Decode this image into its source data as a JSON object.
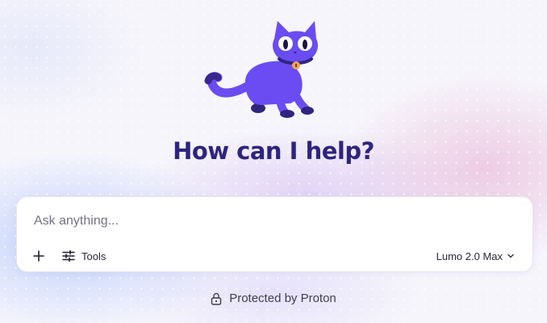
{
  "header": {
    "title": "How can I help?"
  },
  "composer": {
    "placeholder": "Ask anything...",
    "value": "",
    "add_icon": "plus-icon",
    "tools_label": "Tools",
    "tools_icon": "sliders-icon",
    "model_label": "Lumo 2.0 Max",
    "model_icon": "chevron-down-icon"
  },
  "footer": {
    "text": "Protected by Proton",
    "icon": "lock-icon"
  },
  "colors": {
    "accent": "#6d4aff",
    "title": "#2e2480",
    "background": "#f6f5fb"
  }
}
